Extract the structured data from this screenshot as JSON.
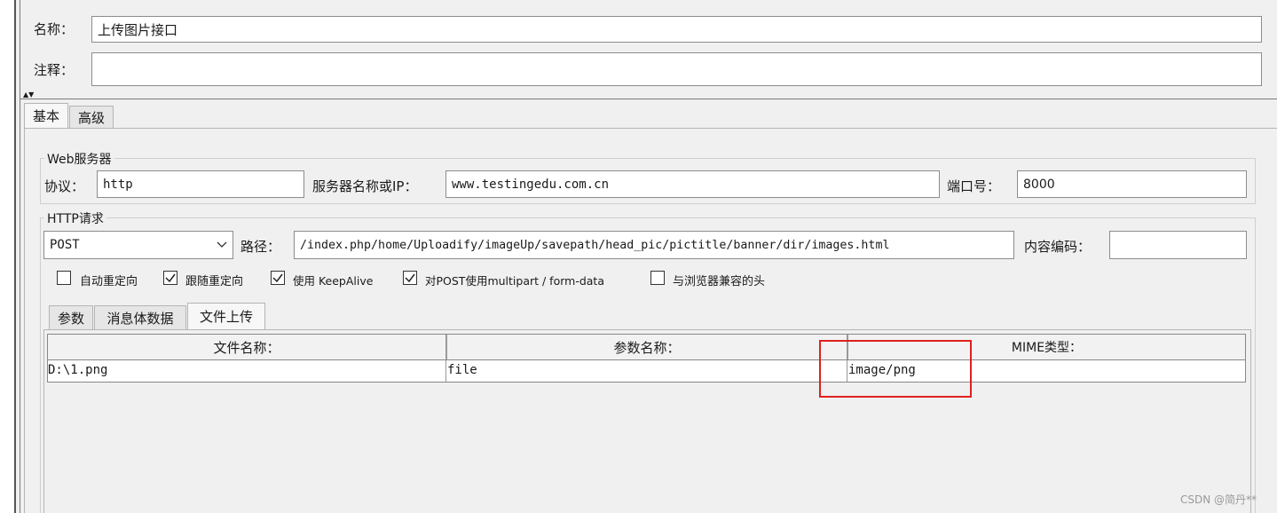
{
  "header": {
    "name_label": "名称：",
    "name_value": "上传图片接口",
    "comment_label": "注释：",
    "comment_value": ""
  },
  "main_tabs": [
    {
      "label": "基本",
      "active": true
    },
    {
      "label": "高级",
      "active": false
    }
  ],
  "web_server": {
    "title": "Web服务器",
    "protocol_label": "协议：",
    "protocol_value": "http",
    "server_label": "服务器名称或IP：",
    "server_value": "www.testingedu.com.cn",
    "port_label": "端口号：",
    "port_value": "8000"
  },
  "http_request": {
    "title": "HTTP请求",
    "method": "POST",
    "path_label": "路径：",
    "path_value": "/index.php/home/Uploadify/imageUp/savepath/head_pic/pictitle/banner/dir/images.html",
    "encoding_label": "内容编码：",
    "encoding_value": ""
  },
  "options": [
    {
      "label": "自动重定向",
      "checked": false
    },
    {
      "label": "跟随重定向",
      "checked": true
    },
    {
      "label": "使用 KeepAlive",
      "checked": true
    },
    {
      "label": "对POST使用multipart / form-data",
      "checked": true
    },
    {
      "label": "与浏览器兼容的头",
      "checked": false
    }
  ],
  "sub_tabs": [
    {
      "label": "参数",
      "active": false
    },
    {
      "label": "消息体数据",
      "active": false
    },
    {
      "label": "文件上传",
      "active": true
    }
  ],
  "file_table": {
    "columns": [
      "文件名称：",
      "参数名称：",
      "MIME类型："
    ],
    "rows": [
      [
        "D:\\1.png",
        "file",
        "image/png"
      ]
    ]
  },
  "highlight_color": "#e02020",
  "watermark": "CSDN @简丹**"
}
